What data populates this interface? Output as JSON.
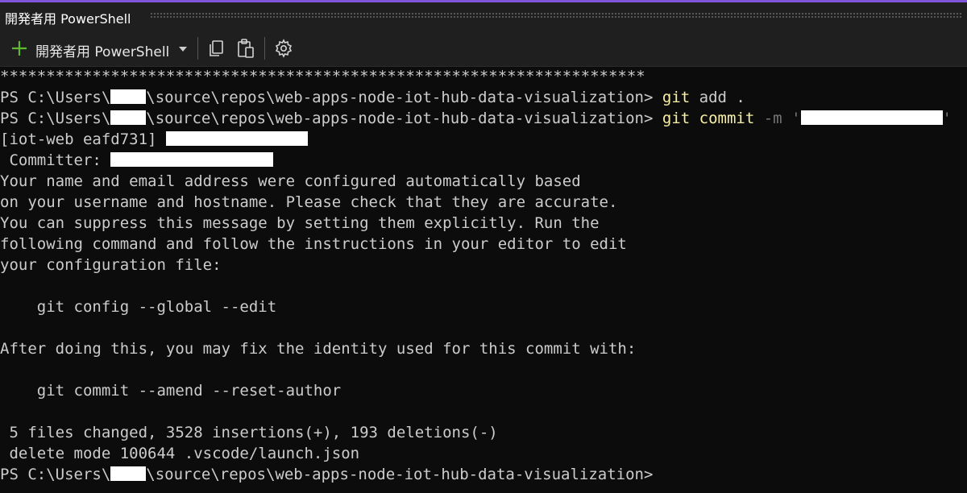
{
  "window": {
    "title": "開発者用 PowerShell"
  },
  "toolbar": {
    "profile_label": "開発者用 PowerShell",
    "icons": [
      "plus-icon",
      "chevron-down-icon",
      "copy-icon",
      "paste-icon",
      "gear-icon"
    ]
  },
  "colors": {
    "accent": "#7f56d9",
    "plus": "#5fb832",
    "command_yellow": "#f9f1a5",
    "terminal_bg": "#0c0c0c"
  },
  "terminal": {
    "stars": "**********************************************************************",
    "prompt_pre": "PS C:\\Users\\",
    "prompt_path": "\\source\\repos\\web-apps-node-iot-hub-data-visualization>",
    "cmd_git": "git",
    "cmd1_rest": " add .",
    "cmd2_rest": " commit ",
    "cmd2_flag": "-m ",
    "quote": "'",
    "commit_line_pre": "[iot-web eafd731] ",
    "committer_pre": " Committer: ",
    "msg": [
      "Your name and email address were configured automatically based",
      "on your username and hostname. Please check that they are accurate.",
      "You can suppress this message by setting them explicitly. Run the",
      "following command and follow the instructions in your editor to edit",
      "your configuration file:"
    ],
    "cmd_config": "    git config --global --edit",
    "after_msg": "After doing this, you may fix the identity used for this commit with:",
    "cmd_amend": "    git commit --amend --reset-author",
    "summary": " 5 files changed, 3528 insertions(+), 193 deletions(-)",
    "delete_line": " delete mode 100644 .vscode/launch.json"
  }
}
